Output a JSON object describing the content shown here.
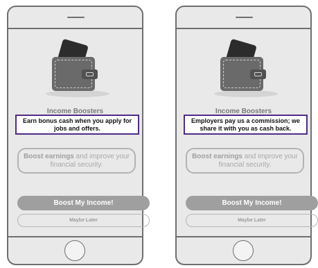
{
  "screens": [
    {
      "title": "Income Boosters",
      "headline": "Earn bonus cash when you apply for jobs and offers.",
      "boost_bold": "Boost earnings",
      "boost_text": " and improve your financial security.",
      "primary_button": "Boost My Income!",
      "secondary_button": "Maybe Later"
    },
    {
      "title": "Income Boosters",
      "headline": "Employers pay us a commission; we share it with you as cash back.",
      "boost_bold": "Boost earnings",
      "boost_text": " and improve your financial security.",
      "primary_button": "Boost My Income!",
      "secondary_button": "Maybe Later"
    }
  ],
  "icons": {
    "wallet": "wallet-icon",
    "home": "home-button-icon",
    "speaker": "speaker-icon"
  }
}
